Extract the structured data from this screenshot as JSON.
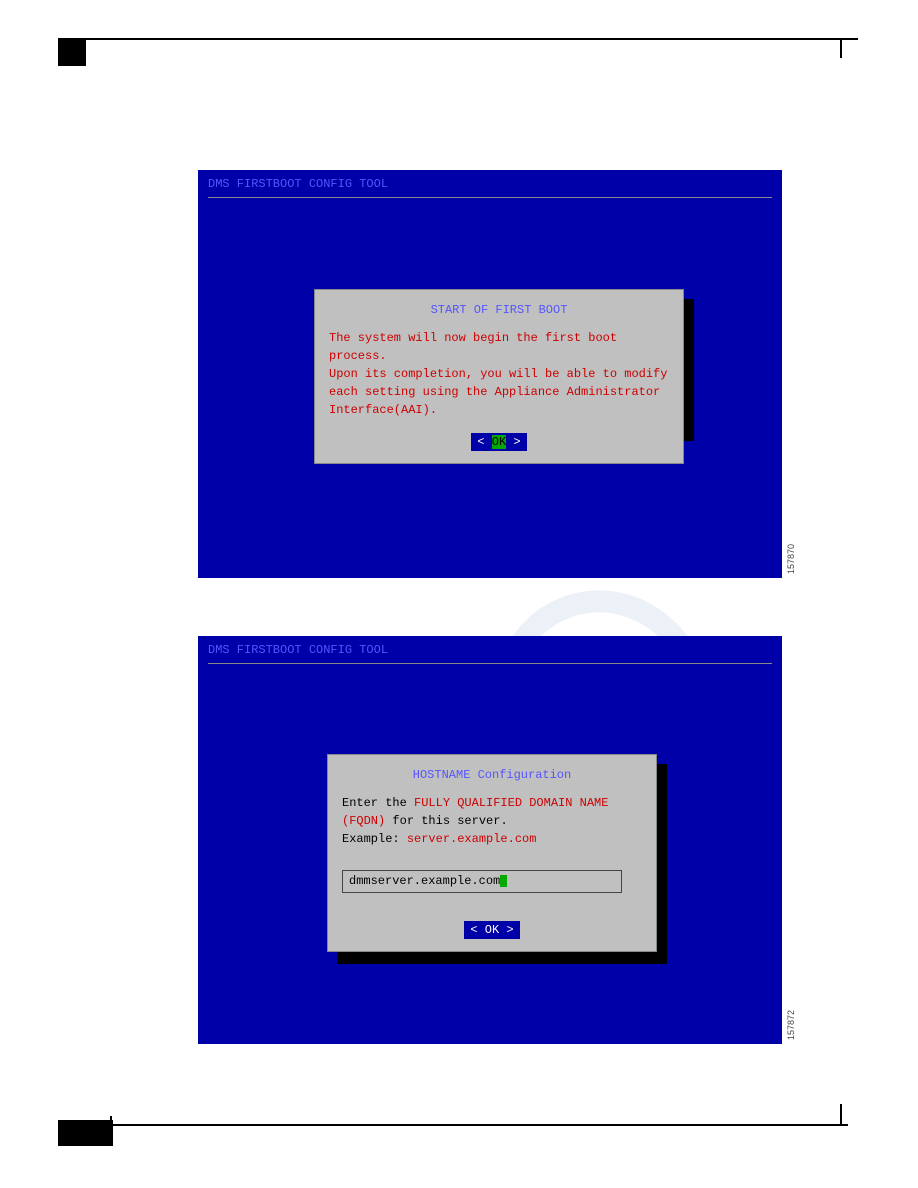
{
  "screen1": {
    "header": "DMS FIRSTBOOT CONFIG TOOL",
    "side_label": "157870",
    "dialog": {
      "title": "START OF FIRST BOOT",
      "body_line1": "The system will now begin the first boot process.",
      "body_line2": "Upon its completion, you will be able to modify each setting using the Appliance Administrator Interface(AAI).",
      "ok_left": "<",
      "ok_label": "OK",
      "ok_right": ">"
    }
  },
  "screen2": {
    "header": "DMS FIRSTBOOT CONFIG TOOL",
    "side_label": "157872",
    "dialog": {
      "title": "HOSTNAME Configuration",
      "prompt_prefix": "Enter the ",
      "prompt_emph": "FULLY QUALIFIED DOMAIN NAME (FQDN)",
      "prompt_suffix": " for this server.",
      "example_label": "Example: ",
      "example_value": "server.example.com",
      "input_value": "dmmserver.example.com",
      "ok_left": "<",
      "ok_label": "OK",
      "ok_right": ">"
    }
  }
}
